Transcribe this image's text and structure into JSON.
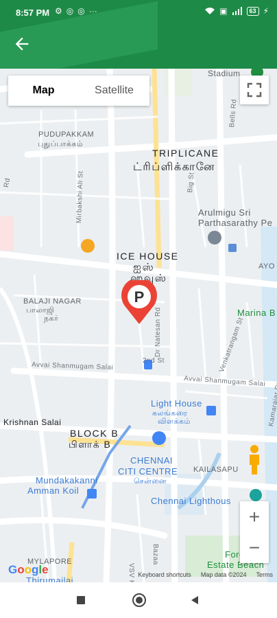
{
  "status_bar": {
    "time": "8:57 PM",
    "battery": "63"
  },
  "header": {
    "back_icon": "arrow-left-icon",
    "color": "#1e8a47"
  },
  "map_controls": {
    "map_tab": "Map",
    "satellite_tab": "Satellite",
    "zoom_in": "+",
    "zoom_out": "−"
  },
  "map_labels": {
    "pudupakkam_en": "PUDUPAKKAM",
    "pudupakkam_ta": "புதுப்பாக்கம்",
    "triplicane_en": "TRIPLICANE",
    "triplicane_ta": "ட்ரிப்ளிக்கானே",
    "temple_line1": "Arulmigu Sri",
    "temple_line2": "Parthasarathy Pe",
    "ice_house_en": "ICE HOUSE",
    "ice_house_ta1": "ஐஸ்",
    "ice_house_ta2": "ஹவுஸ்",
    "balaji_en": "BALAJI NAGAR",
    "balaji_ta1": "பாலாஜி",
    "balaji_ta2": "நகர்",
    "marina": "Marina B",
    "ayothya": "AYO",
    "avvai_salai_1": "Avvai Shanmugam Salai",
    "avvai_salai_2": "Avvai Shanmugam Salai",
    "light_house_en": "Light House",
    "light_house_ta1": "கலங்கரை",
    "light_house_ta2": "விளக்கம்",
    "krishnan_salai": "Krishnan Salai",
    "block_b_en": "BLOCK B",
    "block_b_ta": "பிளாக் B",
    "chennai_citi_1": "CHENNAI",
    "chennai_citi_2": "CITI CENTRE",
    "chennai_citi_ta": "சென்னை",
    "kailasapuram": "KAILASAPU",
    "mundakakanni_1": "Mundakakanni",
    "mundakakanni_2": "Amman Koil",
    "chennai_lighthouse": "Chennai Lighthous",
    "mylapore": "MYLAPORE",
    "thirumailai": "Thirumailai",
    "fore_estate": "Fore",
    "estate_beach": "Estate Beach",
    "stadium": "Stadium",
    "dr_natesan": "Dr Natesan Rd",
    "second_st": "2nd St",
    "venkatrangam": "Venkatrangam St",
    "mirbakshi": "Mirbakshi Ali St",
    "big_st": "Big St",
    "bells_rd": "Bells Rd",
    "kamarajar": "Kamarajar Prom",
    "vsv_koil": "VSV Koil St",
    "bazaar": "Bazaa",
    "rd": "Rd"
  },
  "attribution": {
    "google": "Google",
    "shortcuts": "Keyboard shortcuts",
    "data": "Map data ©2024",
    "terms": "Terms"
  },
  "marker": {
    "label": "P",
    "color": "#ea4335"
  }
}
